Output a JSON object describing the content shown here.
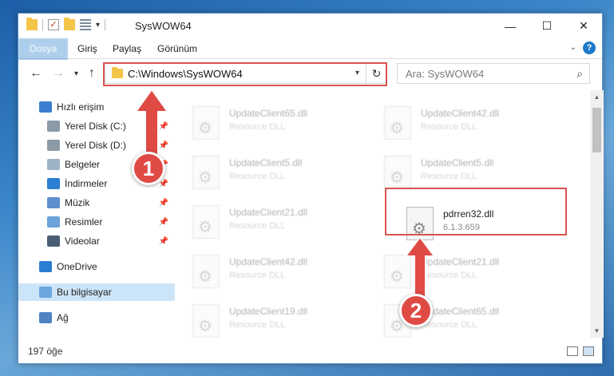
{
  "window": {
    "title": "SysWOW64"
  },
  "ribbon": {
    "tabs": [
      {
        "label": "Dosya"
      },
      {
        "label": "Giriş"
      },
      {
        "label": "Paylaş"
      },
      {
        "label": "Görünüm"
      }
    ],
    "help": "?"
  },
  "controls": {
    "minimize": "—",
    "maximize": "☐",
    "close": "✕"
  },
  "address": {
    "path": "C:\\Windows\\SysWOW64"
  },
  "search": {
    "placeholder": "Ara: SysWOW64"
  },
  "sidebar": {
    "items": [
      {
        "label": "Hızlı erişim"
      },
      {
        "label": "Yerel Disk (C:)"
      },
      {
        "label": "Yerel Disk (D:)"
      },
      {
        "label": "Belgeler"
      },
      {
        "label": "İndirmeler"
      },
      {
        "label": "Müzik"
      },
      {
        "label": "Resimler"
      },
      {
        "label": "Videolar"
      },
      {
        "label": "OneDrive"
      },
      {
        "label": "Bu bilgisayar"
      },
      {
        "label": "Ağ"
      }
    ]
  },
  "files": [
    {
      "name": "UpdateClient65.dll",
      "sub": "Resource DLL"
    },
    {
      "name": "UpdateClient42.dll",
      "sub": "Resource DLL"
    },
    {
      "name": "UpdateClient5.dll",
      "sub": "Resource DLL"
    },
    {
      "name": "UpdateClient5.dll",
      "sub": "Resource DLL"
    },
    {
      "name": "UpdateClient21.dll",
      "sub": "Resource DLL"
    },
    {
      "name": "pdrren32.dll",
      "sub": "6.1.3.659"
    },
    {
      "name": "UpdateClient42.dll",
      "sub": "Resource DLL"
    },
    {
      "name": "UpdateClient21.dll",
      "sub": "Resource DLL"
    },
    {
      "name": "UpdateClient19.dll",
      "sub": "Resource DLL"
    },
    {
      "name": "UpdateClient65.dll",
      "sub": "Resource DLL"
    }
  ],
  "status": {
    "count": "197 öğe"
  },
  "annotations": {
    "badge1": "1",
    "badge2": "2",
    "color": "#e04a45"
  }
}
